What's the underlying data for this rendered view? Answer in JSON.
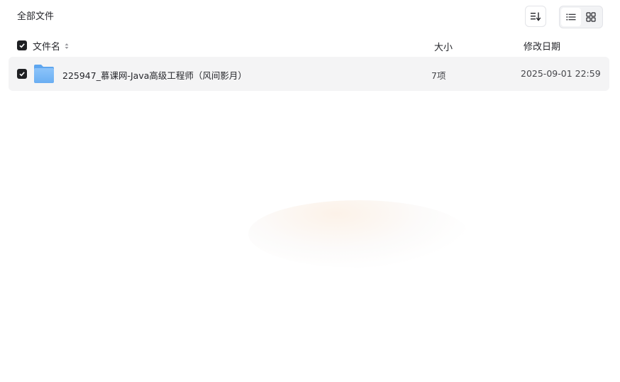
{
  "header": {
    "title": "全部文件",
    "sort_icon": "sort-list-icon",
    "view_list_icon": "list-view-icon",
    "view_grid_icon": "grid-view-icon",
    "active_view": "list"
  },
  "columns": {
    "name": "文件名",
    "size": "大小",
    "date": "修改日期"
  },
  "files": [
    {
      "name": "225947_慕课网-Java高级工程师（风间影月）",
      "size": "7项",
      "modified": "2025-09-01 22:59",
      "type": "folder",
      "checked": true
    }
  ],
  "select_all_checked": true,
  "colors": {
    "folder": "#7ab8f5",
    "row_background": "#f4f4f5",
    "checkbox": "#1f2023"
  }
}
